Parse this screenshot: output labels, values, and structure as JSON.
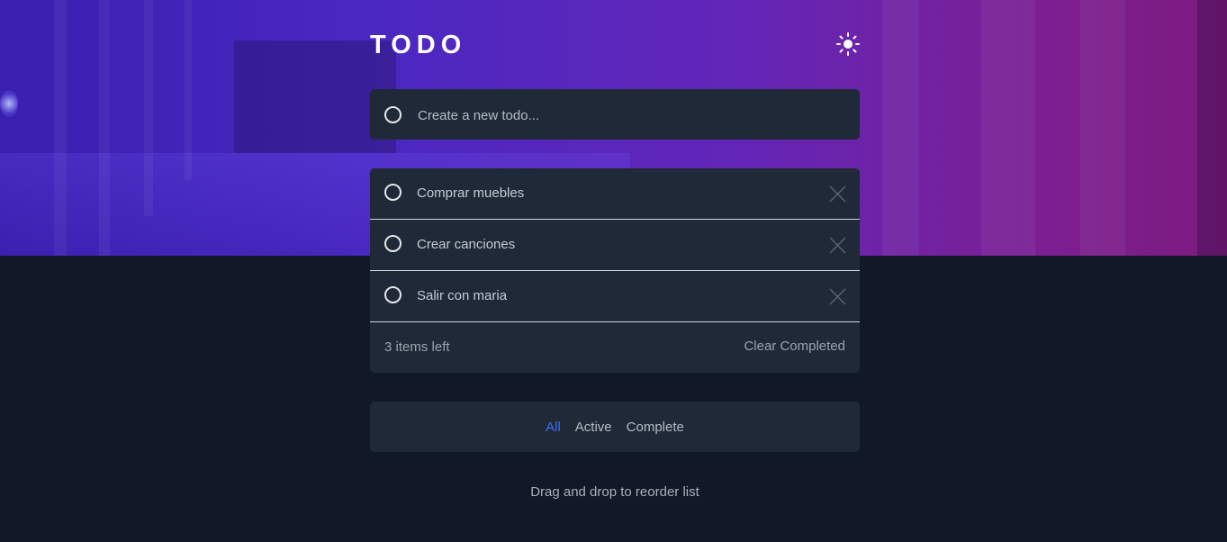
{
  "header": {
    "title": "TODO",
    "theme_icon": "sun-icon"
  },
  "new_todo": {
    "placeholder": "Create a new todo..."
  },
  "todos": [
    {
      "text": "Comprar muebles",
      "completed": false
    },
    {
      "text": "Crear canciones",
      "completed": false
    },
    {
      "text": "Salir con maria",
      "completed": false
    }
  ],
  "footer": {
    "items_left": "3 items left",
    "clear_label": "Clear Completed"
  },
  "filters": {
    "items": [
      "All",
      "Active",
      "Complete"
    ],
    "selected": "All"
  },
  "hint": "Drag and drop to reorder list",
  "colors": {
    "background": "#111827",
    "panel": "#1f2937",
    "accent": "#3b6cf6",
    "hero_start": "#3a1fb0",
    "hero_end": "#7d1b7e"
  }
}
